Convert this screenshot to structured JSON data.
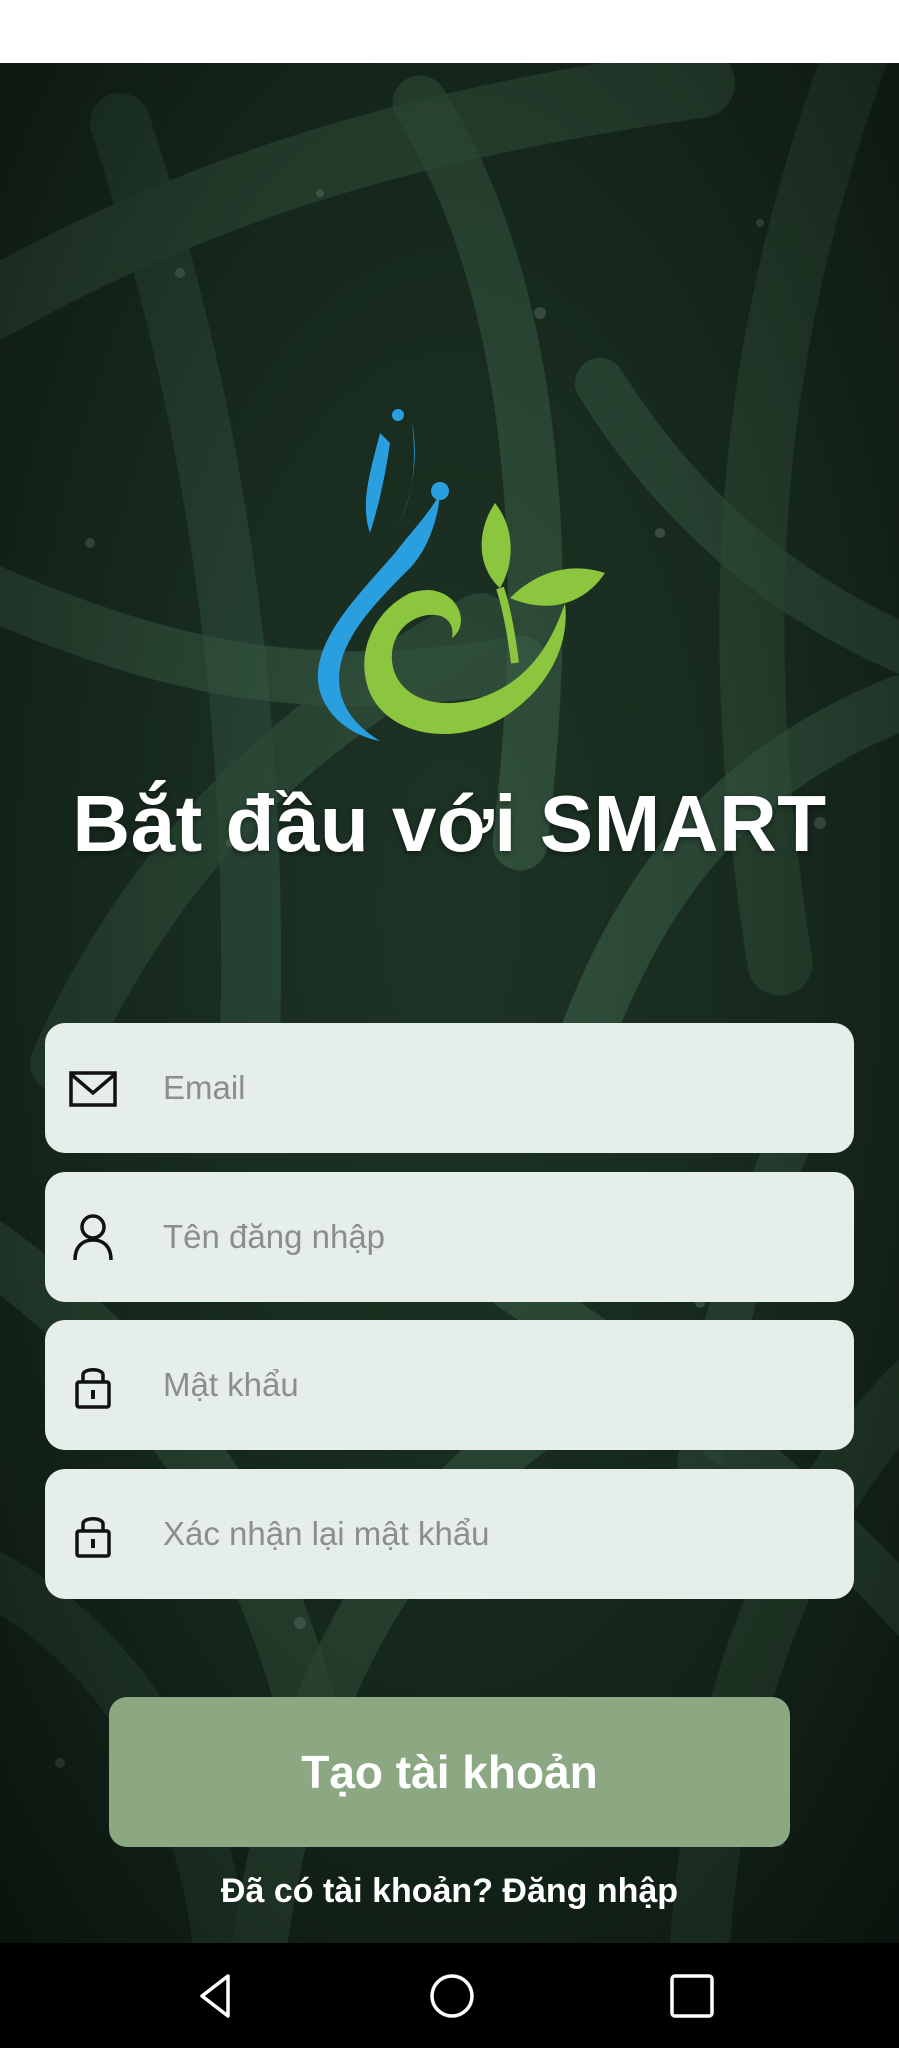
{
  "header": {
    "title": "Bắt đầu với SMART"
  },
  "form": {
    "email_placeholder": "Email",
    "username_placeholder": "Tên đăng nhập",
    "password_placeholder": "Mật khẩu",
    "confirm_password_placeholder": "Xác nhận lại mật khẩu"
  },
  "actions": {
    "create_account_label": "Tạo tài khoản",
    "login_link_label": "Đã có tài khoản? Đăng nhập"
  },
  "icons": {
    "email": "envelope-icon",
    "username": "user-icon",
    "password": "lock-icon",
    "confirm_password": "lock-icon",
    "nav_back": "triangle-back-icon",
    "nav_home": "circle-home-icon",
    "nav_recents": "square-recents-icon"
  },
  "colors": {
    "background": "#0f1d14",
    "field_background": "#e6eee9",
    "button_background": "#8ba883",
    "logo_blue": "#2a9fe0",
    "logo_green": "#8cc63f"
  }
}
